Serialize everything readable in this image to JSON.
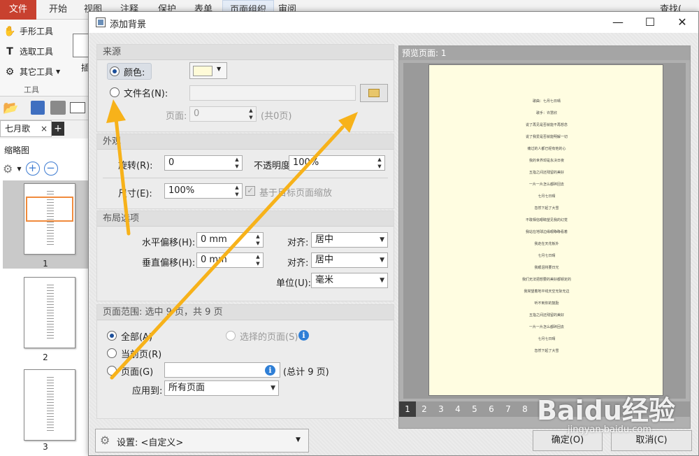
{
  "app": {
    "tabs": [
      "文件",
      "开始",
      "视图",
      "注释",
      "保护",
      "表单",
      "页面组织",
      "审阅"
    ],
    "right_tab": "查找(",
    "tools": [
      "手形工具",
      "选取工具",
      "其它工具"
    ],
    "tools_group": "工具",
    "ribbon_partial": "插",
    "doc_tab": "七月歌",
    "sidebar_title": "缩略图",
    "thumb_numbers": [
      "1",
      "2",
      "3"
    ]
  },
  "dialog": {
    "title": "添加背景",
    "win_buttons": [
      "—",
      "☐",
      "✕"
    ],
    "source": {
      "heading": "来源",
      "color_label": "颜色:",
      "color_swatch": "#fffbd8",
      "filename_label": "文件名(N):",
      "filename_value": "",
      "page_label": "页面:",
      "page_value": "0",
      "page_total": "(共0页)"
    },
    "appearance": {
      "heading": "外观",
      "rotation_label": "旋转(R):",
      "rotation_value": "0",
      "opacity_label": "不透明度(O):",
      "opacity_value": "100%",
      "size_label": "尺寸(E):",
      "size_value": "100%",
      "scale_label": "基于目标页面缩放"
    },
    "layout": {
      "heading": "布局选项",
      "h_offset_label": "水平偏移(H):",
      "h_offset_value": "0 mm",
      "v_offset_label": "垂直偏移(H):",
      "v_offset_value": "0 mm",
      "align_label": "对齐:",
      "h_align_value": "居中",
      "v_align_value": "居中",
      "unit_label": "单位(U):",
      "unit_value": "毫米"
    },
    "range": {
      "heading": "页面范围: 选中 9 页，共 9 页",
      "all_label": "全部(A)",
      "selected_label": "选择的页面(S)",
      "current_label": "当前页(R)",
      "pages_label": "页面(G)",
      "pages_value": "",
      "pages_total": "(总计 9 页)",
      "apply_label": "应用到:",
      "apply_value": "所有页面"
    },
    "preview": {
      "heading": "预览页面: 1",
      "page_lines": [
        "歌曲：七月七日晴",
        "歌手：许慧欣",
        "说了再见是否就能不再想念",
        "说了我爱是否就能明解一切",
        "痛过的人都已经有他的心",
        "我的世界却是永决日夜",
        "五指之间还残留的美好",
        "一片一片怎么都碎回去",
        "七月七日晴",
        "忽然下起了大雪",
        "不敢相信眼睛望见我的幻觉",
        "我站在地球边缘眼睁睁看着",
        "我走在天花板外",
        "七月七日晴",
        "我眼泪将要日光",
        "我们无法把想要的美好都钥定的",
        "我常望着地平线天空无际无边",
        "听不到你的鼓励",
        "五指之间还残留的美好",
        "一片一片怎么都碎回去",
        "七月七日晴",
        "忽然下起了大雪"
      ],
      "pages": [
        "1",
        "2",
        "3",
        "4",
        "5",
        "6",
        "7",
        "8"
      ]
    },
    "settings_label": "设置: <自定义>",
    "ok_label": "确定(O)",
    "cancel_label": "取消(C)"
  },
  "watermark": {
    "logo": "Baidu经验",
    "url": "jingyan.baidu.com"
  },
  "colors": {
    "arrow": "#f7b21a",
    "accent": "#2f7fd6"
  }
}
